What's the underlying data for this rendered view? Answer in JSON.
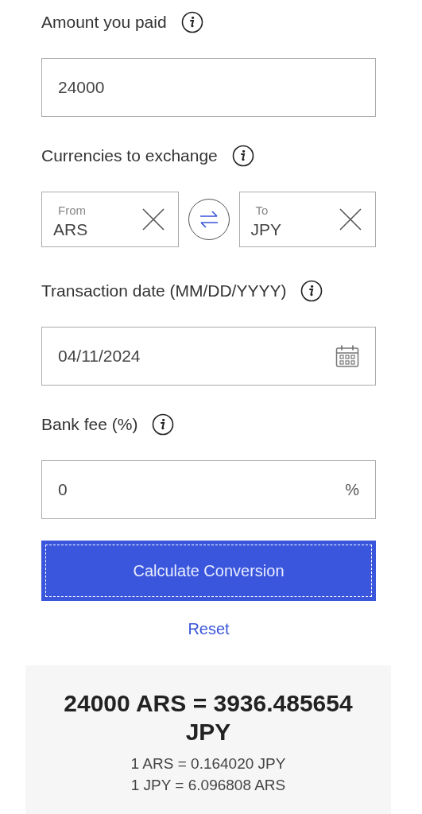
{
  "fields": [
    {
      "kind": "amount",
      "label": "Amount you paid",
      "value": "24000"
    },
    {
      "kind": "currencies",
      "label": "Currencies to exchange",
      "from": {
        "label": "From",
        "value": "ARS"
      },
      "to": {
        "label": "To",
        "value": "JPY"
      }
    },
    {
      "kind": "date",
      "label": "Transaction date (MM/DD/YYYY)",
      "value": "04/11/2024"
    },
    {
      "kind": "percent",
      "label": "Bank fee (%)",
      "value": "0",
      "suffix": "%"
    }
  ],
  "calculate_button": {
    "label": "Calculate Conversion",
    "focused": true
  },
  "reset_link": "Reset",
  "result": {
    "headline": "24000 ARS = 3936.485654 JPY",
    "rates": [
      "1 ARS = 0.164020 JPY",
      "1 JPY = 6.096808 ARS"
    ]
  }
}
